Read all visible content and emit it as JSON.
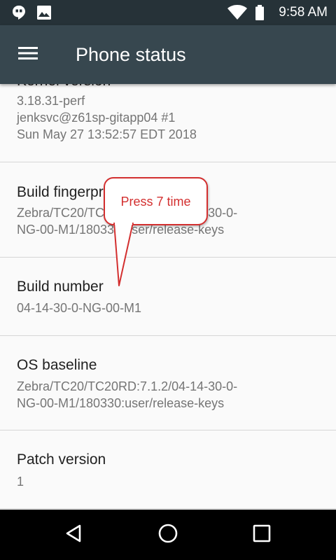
{
  "status_bar": {
    "time": "9:58 AM",
    "notifications": [
      "hangouts-icon",
      "image-icon"
    ],
    "system_icons": [
      "wifi-icon",
      "battery-icon"
    ]
  },
  "toolbar": {
    "title": "Phone status",
    "menu_icon": "menu-icon"
  },
  "items": [
    {
      "label": "Kernel version",
      "value": "3.18.31-perf\njenksvc@z61sp-gitapp04 #1\nSun May 27 13:52:57 EDT 2018"
    },
    {
      "label": "Build fingerprint",
      "value": "Zebra/TC20/TC20RD:7.1.2/04-14-30-0-\nNG-00-M1/180330:user/release-keys"
    },
    {
      "label": "Build number",
      "value": "04-14-30-0-NG-00-M1"
    },
    {
      "label": "OS baseline",
      "value": "Zebra/TC20/TC20RD:7.1.2/04-14-30-0-\nNG-00-M1/180330:user/release-keys"
    },
    {
      "label": "Patch version",
      "value": "1"
    }
  ],
  "callout": {
    "text": "Press 7 time",
    "color": "#d32f2f"
  },
  "nav_bar": {
    "buttons": [
      "back-icon",
      "home-icon",
      "recents-icon"
    ]
  },
  "colors": {
    "status_bar": "#263238",
    "toolbar": "#37474f",
    "background": "#fafafa",
    "primary_text": "#212121",
    "secondary_text": "#757575",
    "nav_bar": "#000000"
  }
}
